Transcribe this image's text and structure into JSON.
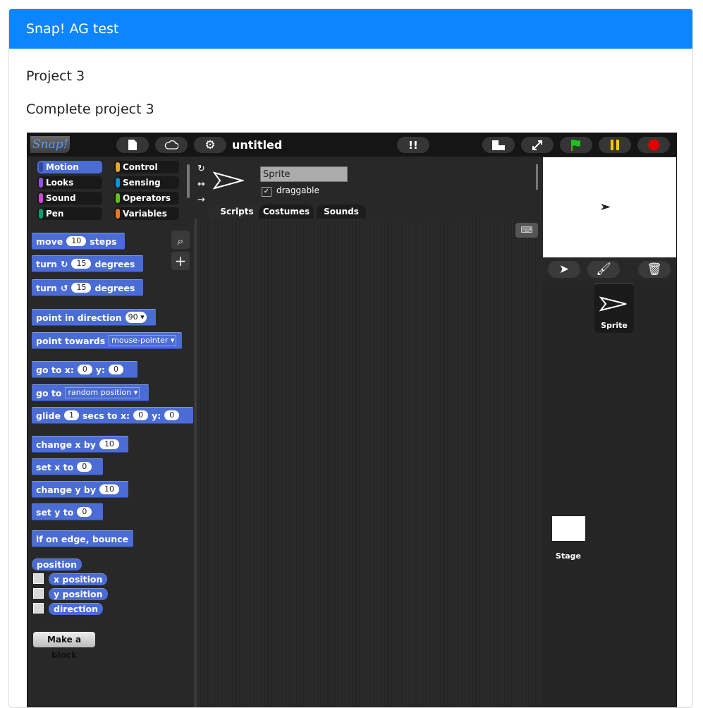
{
  "header": {
    "title": "Snap! AG test"
  },
  "content": {
    "heading": "Project 3",
    "instruction": "Complete project 3"
  },
  "snap": {
    "logo": "Snap!",
    "project_title": "untitled",
    "categories": [
      "Motion",
      "Looks",
      "Sound",
      "Pen",
      "Control",
      "Sensing",
      "Operators",
      "Variables"
    ],
    "category_colors": {
      "Motion": "#4a6cd4",
      "Looks": "#8f56e3",
      "Sound": "#cf4ad9",
      "Pen": "#00a178",
      "Control": "#e6a822",
      "Sensing": "#0494dc",
      "Operators": "#62c213",
      "Variables": "#f3761d"
    },
    "selected_category": "Motion",
    "sprite_name": "Sprite",
    "draggable_label": "draggable",
    "tabs": [
      "Scripts",
      "Costumes",
      "Sounds"
    ],
    "blocks": {
      "move": {
        "a": "move",
        "v": "10",
        "b": "steps"
      },
      "turn_cw": {
        "a": "turn",
        "v": "15",
        "b": "degrees"
      },
      "turn_ccw": {
        "a": "turn",
        "v": "15",
        "b": "degrees"
      },
      "point_dir": {
        "a": "point in direction",
        "v": "90"
      },
      "point_towards": {
        "a": "point towards",
        "v": "mouse-pointer"
      },
      "goto_xy": {
        "a": "go to x:",
        "v1": "0",
        "b": "y:",
        "v2": "0"
      },
      "goto": {
        "a": "go to",
        "v": "random position"
      },
      "glide": {
        "a": "glide",
        "v1": "1",
        "b": "secs to x:",
        "v2": "0",
        "c": "y:",
        "v3": "0"
      },
      "change_x": {
        "a": "change x by",
        "v": "10"
      },
      "set_x": {
        "a": "set x to",
        "v": "0"
      },
      "change_y": {
        "a": "change y by",
        "v": "10"
      },
      "set_y": {
        "a": "set y to",
        "v": "0"
      },
      "bounce": {
        "a": "if on edge, bounce"
      },
      "position": "position",
      "x_position": "x position",
      "y_position": "y position",
      "direction": "direction",
      "make_block": "Make a block"
    },
    "corral": {
      "sprite_label": "Sprite",
      "stage_label": "Stage"
    }
  }
}
